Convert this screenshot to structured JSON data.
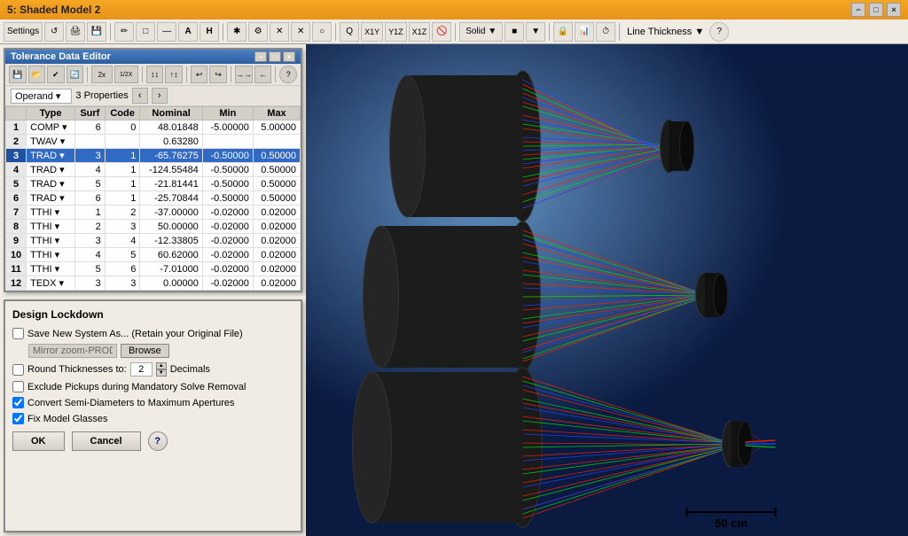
{
  "title_bar": {
    "title": "5: Shaded Model 2",
    "min_label": "−",
    "max_label": "□",
    "close_label": "×"
  },
  "toolbar": {
    "items": [
      "Settings",
      "⟳",
      "🖨",
      "💾",
      "✏",
      "□",
      "—",
      "A",
      "H",
      "✱",
      "⚙",
      "✕",
      "✕",
      "○",
      "●",
      "Q",
      "X1Y",
      "Y1Z",
      "X1Z",
      "🚫",
      "⬜",
      "⚙",
      "Solid ▼",
      "■",
      "▼",
      "🔒",
      "📊",
      "⏱",
      "Line Thickness ▼",
      "?"
    ]
  },
  "tde": {
    "title": "Tolerance Data Editor",
    "toolbar_buttons": [
      "💾",
      "📂",
      "✔",
      "🔄",
      "2x",
      "1/2X",
      "↕↕",
      "↕↑",
      "↩",
      "↪",
      "→→",
      "⟵",
      "?"
    ],
    "operand_label": "Operand",
    "properties_label": "3 Properties",
    "columns": [
      "",
      "Type",
      "Surf",
      "Code",
      "Nominal",
      "Min",
      "Max"
    ],
    "rows": [
      {
        "row": "1",
        "type": "COMP",
        "surf": "6",
        "code": "0",
        "nominal": "48.01848",
        "min": "-5.00000",
        "max": "5.00000"
      },
      {
        "row": "2",
        "type": "TWAV",
        "surf": "",
        "code": "",
        "nominal": "0.63280",
        "min": "",
        "max": ""
      },
      {
        "row": "3",
        "type": "TRAD",
        "surf": "3",
        "code": "1",
        "nominal": "-65.76275",
        "min": "-0.50000",
        "max": "0.50000",
        "selected": true
      },
      {
        "row": "4",
        "type": "TRAD",
        "surf": "4",
        "code": "1",
        "nominal": "-124.55484",
        "min": "-0.50000",
        "max": "0.50000"
      },
      {
        "row": "5",
        "type": "TRAD",
        "surf": "5",
        "code": "1",
        "nominal": "-21.81441",
        "min": "-0.50000",
        "max": "0.50000"
      },
      {
        "row": "6",
        "type": "TRAD",
        "surf": "6",
        "code": "1",
        "nominal": "-25.70844",
        "min": "-0.50000",
        "max": "0.50000"
      },
      {
        "row": "7",
        "type": "TTHI",
        "surf": "1",
        "code": "2",
        "nominal": "-37.00000",
        "min": "-0.02000",
        "max": "0.02000"
      },
      {
        "row": "8",
        "type": "TTHI",
        "surf": "2",
        "code": "3",
        "nominal": "50.00000",
        "min": "-0.02000",
        "max": "0.02000"
      },
      {
        "row": "9",
        "type": "TTHI",
        "surf": "3",
        "code": "4",
        "nominal": "-12.33805",
        "min": "-0.02000",
        "max": "0.02000"
      },
      {
        "row": "10",
        "type": "TTHI",
        "surf": "4",
        "code": "5",
        "nominal": "60.62000",
        "min": "-0.02000",
        "max": "0.02000"
      },
      {
        "row": "11",
        "type": "TTHI",
        "surf": "5",
        "code": "6",
        "nominal": "-7.01000",
        "min": "-0.02000",
        "max": "0.02000"
      },
      {
        "row": "12",
        "type": "TEDX",
        "surf": "3",
        "code": "3",
        "nominal": "0.00000",
        "min": "-0.02000",
        "max": "0.02000"
      }
    ]
  },
  "design_lockdown": {
    "title": "Design Lockdown",
    "save_new_system_label": "Save New System As... (Retain your Original File)",
    "save_new_system_checked": false,
    "filename_value": "Mirror zoom-PROD.zmx",
    "browse_label": "Browse",
    "round_thicknesses_label": "Round Thicknesses to:",
    "round_thicknesses_checked": false,
    "decimals_value": "2",
    "decimals_label": "Decimals",
    "exclude_pickups_label": "Exclude Pickups during Mandatory Solve Removal",
    "exclude_pickups_checked": false,
    "convert_semi_diameters_label": "Convert Semi-Diameters to Maximum Apertures",
    "convert_semi_diameters_checked": true,
    "fix_model_glasses_label": "Fix Model Glasses",
    "fix_model_glasses_checked": true,
    "ok_label": "OK",
    "cancel_label": "Cancel",
    "help_label": "?"
  },
  "viewport": {
    "scale_value": "50 cm"
  }
}
